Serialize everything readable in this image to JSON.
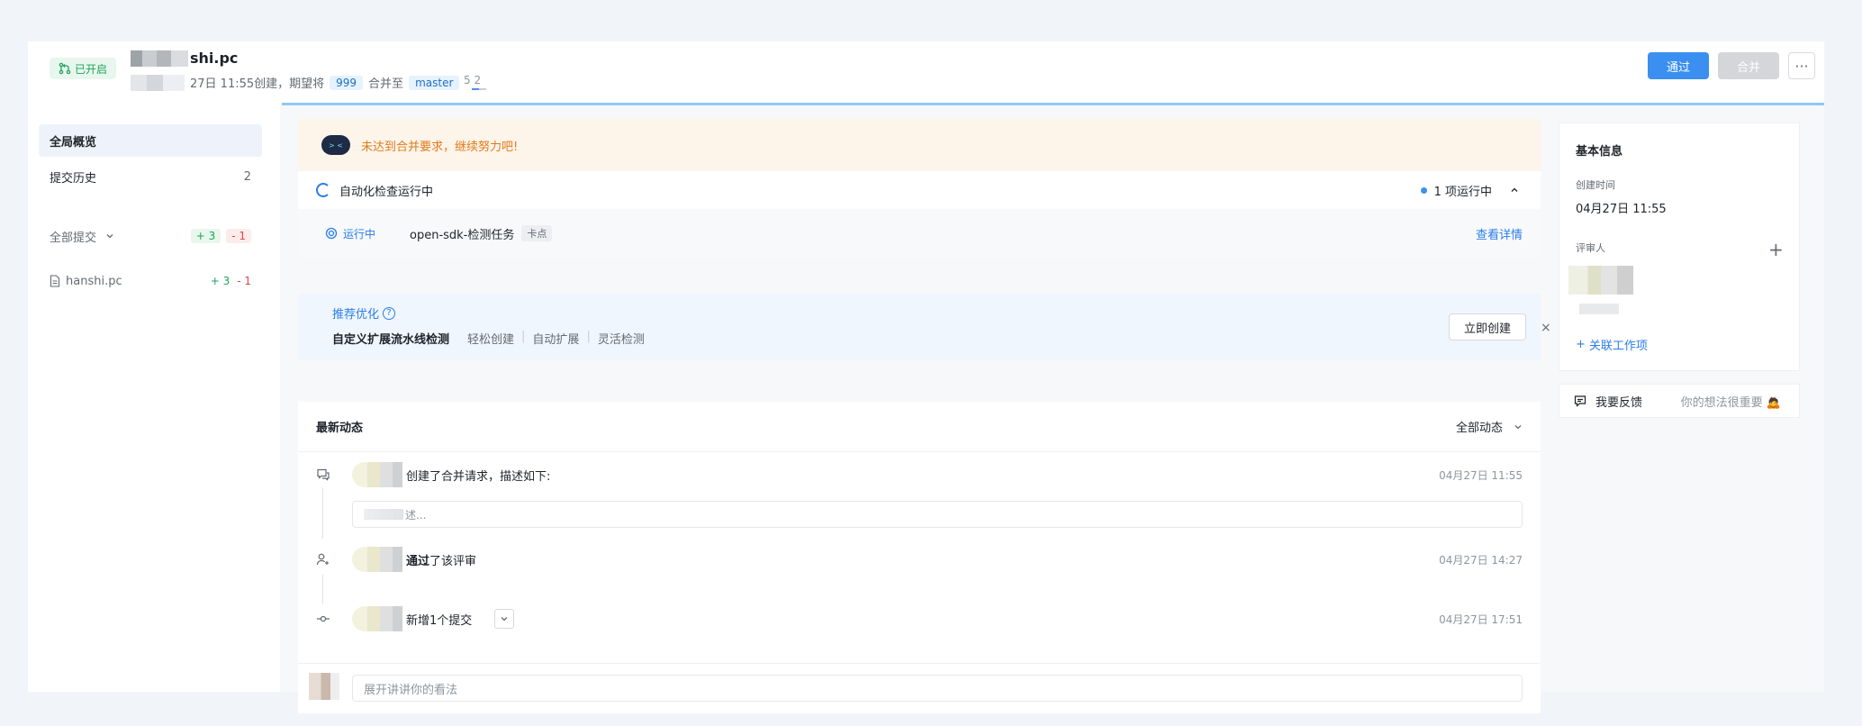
{
  "header": {
    "status": "已开启",
    "title_tail": "shi.pc",
    "meta_date": "27日 11:55创建，期望将",
    "source_branch": "999",
    "merge_to": "合并至",
    "target_branch": "master",
    "ratio": "5 2",
    "pass_label": "通过",
    "merge_label": "合并",
    "more_label": "···",
    "colors": {
      "accent": "#3b8ff0",
      "success": "#22a35a",
      "danger": "#e54545"
    }
  },
  "sidebar": {
    "overview": "全局概览",
    "history": "提交历史",
    "history_count": "2",
    "all_commits": "全部提交",
    "add_total": "+ 3",
    "del_total": "- 1",
    "file_name": "hanshi.pc",
    "file_add": "+ 3",
    "file_del": "- 1"
  },
  "main": {
    "warning": "未达到合并要求，继续努力吧!",
    "robot_face": "> <",
    "auto_check": "自动化检查运行中",
    "running_count": "1 项运行中",
    "task_status": "运行中",
    "task_name": "open-sdk-检测任务",
    "task_gate": "卡点",
    "view_detail": "查看详情",
    "recommend": {
      "title": "推荐优化",
      "help": "?",
      "headline": "自定义扩展流水线检测",
      "items": [
        "轻松创建",
        "自动扩展",
        "灵活检测"
      ],
      "separator": "|",
      "create_button": "立即创建",
      "close": "×"
    },
    "activity": {
      "title": "最新动态",
      "filter": "全部动态",
      "rows": [
        {
          "text": "创建了合并请求，描述如下:",
          "time": "04月27日 11:55"
        },
        {
          "bold": "通过",
          "text": "了该评审",
          "time": "04月27日 14:27"
        },
        {
          "text": "新增1个提交",
          "time": "04月27日 17:51"
        }
      ],
      "desc_placeholder": "述...",
      "comment_placeholder": "展开讲讲你的看法"
    }
  },
  "right": {
    "title": "基本信息",
    "created_label": "创建时间",
    "created_value": "04月27日 11:55",
    "reviewer_label": "评审人",
    "add_reviewer": "+",
    "link_work": "关联工作项",
    "link_plus": "+",
    "feedback": "我要反馈",
    "feedback_hint": "你的想法很重要 🙇"
  }
}
